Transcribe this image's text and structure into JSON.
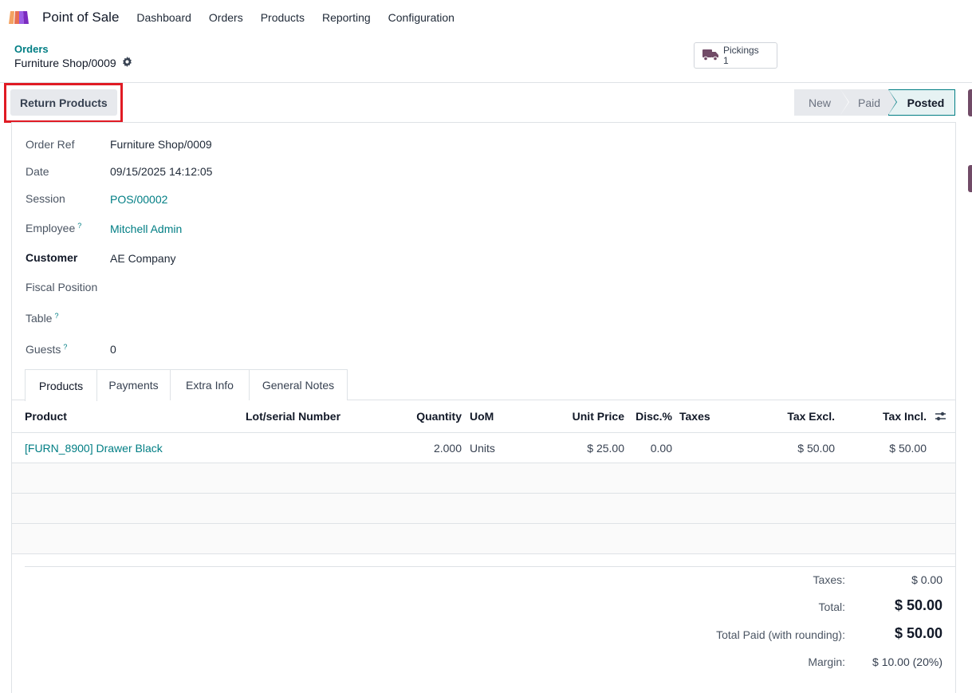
{
  "topbar": {
    "app_name": "Point of Sale",
    "menu": [
      "Dashboard",
      "Orders",
      "Products",
      "Reporting",
      "Configuration"
    ]
  },
  "control_panel": {
    "breadcrumb": "Orders",
    "record_title": "Furniture Shop/0009",
    "smart_button": {
      "label": "Pickings",
      "count": "1"
    }
  },
  "actions": {
    "return_products": "Return Products"
  },
  "statusbar": {
    "stages": [
      "New",
      "Paid",
      "Posted"
    ],
    "current": "Posted"
  },
  "fields": {
    "order_ref": {
      "label": "Order Ref",
      "value": "Furniture Shop/0009"
    },
    "date": {
      "label": "Date",
      "value": "09/15/2025 14:12:05"
    },
    "session": {
      "label": "Session",
      "value": "POS/00002"
    },
    "employee": {
      "label": "Employee",
      "value": "Mitchell Admin",
      "help": "?"
    },
    "customer": {
      "label": "Customer",
      "value": "AE Company"
    },
    "fiscal_position": {
      "label": "Fiscal Position",
      "value": ""
    },
    "table": {
      "label": "Table",
      "value": "",
      "help": "?"
    },
    "guests": {
      "label": "Guests",
      "value": "0",
      "help": "?"
    }
  },
  "tabs": [
    "Products",
    "Payments",
    "Extra Info",
    "General Notes"
  ],
  "lines_table": {
    "headers": {
      "product": "Product",
      "lot": "Lot/serial Number",
      "quantity": "Quantity",
      "uom": "UoM",
      "unit_price": "Unit Price",
      "disc": "Disc.%",
      "taxes": "Taxes",
      "tax_excl": "Tax Excl.",
      "tax_incl": "Tax Incl."
    },
    "rows": [
      {
        "product": "[FURN_8900] Drawer Black",
        "lot": "",
        "quantity": "2.000",
        "uom": "Units",
        "unit_price": "$ 25.00",
        "disc": "0.00",
        "taxes": "",
        "tax_excl": "$ 50.00",
        "tax_incl": "$ 50.00"
      }
    ]
  },
  "totals": {
    "taxes": {
      "label": "Taxes:",
      "value": "$ 0.00"
    },
    "total": {
      "label": "Total:",
      "value": "$ 50.00"
    },
    "total_paid": {
      "label": "Total Paid (with rounding):",
      "value": "$ 50.00"
    },
    "margin": {
      "label": "Margin:",
      "value": "$ 10.00 (20%)"
    }
  },
  "colors": {
    "brand": "#714b67",
    "link": "#017e84",
    "highlight": "#e01b24"
  }
}
